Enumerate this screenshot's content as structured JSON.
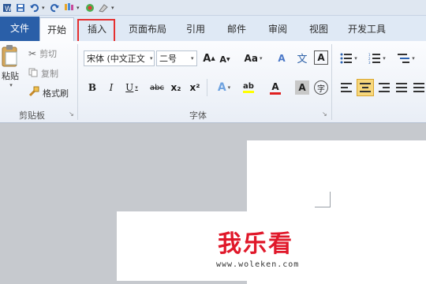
{
  "quick_access": {
    "icons": [
      "app-icon",
      "save-icon",
      "undo-icon",
      "redo-icon",
      "format-painter-icon",
      "color-icon",
      "eraser-icon",
      "customize-icon"
    ]
  },
  "tabs": [
    {
      "label": "文件"
    },
    {
      "label": "开始"
    },
    {
      "label": "插入"
    },
    {
      "label": "页面布局"
    },
    {
      "label": "引用"
    },
    {
      "label": "邮件"
    },
    {
      "label": "审阅"
    },
    {
      "label": "视图"
    },
    {
      "label": "开发工具"
    }
  ],
  "clipboard": {
    "paste": "粘贴",
    "cut": "剪切",
    "copy": "复制",
    "format_painter": "格式刷",
    "group_label": "剪贴板"
  },
  "font": {
    "font_name": "宋体 (中文正文",
    "font_size": "二号",
    "grow": "A",
    "shrink": "A",
    "case": "Aa",
    "clear": "A",
    "phonetic": "文",
    "border": "A",
    "bold": "B",
    "italic": "I",
    "underline": "U",
    "strike": "abc",
    "sub": "x₂",
    "sup": "x²",
    "effects": "A",
    "highlight": "ab",
    "color": "A",
    "shade": "A",
    "enclose": "字",
    "group_label": "字体"
  },
  "watermark": {
    "text": "我乐看",
    "url": "www.woleken.com"
  },
  "colors": {
    "file_tab": "#2a5fa8",
    "highlight_box": "#e53030",
    "watermark_red": "#e0182a"
  }
}
